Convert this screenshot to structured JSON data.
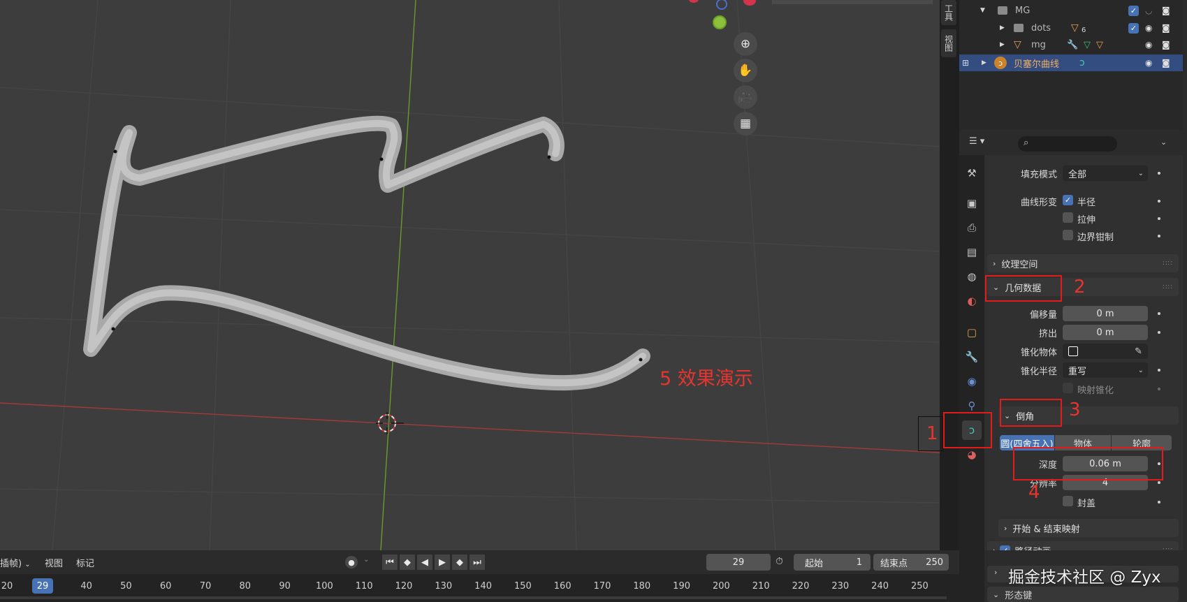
{
  "viewport": {
    "demo_label": "5 效果演示"
  },
  "side_tabs": [
    "工具",
    "视图"
  ],
  "outliner": {
    "rows": [
      {
        "name": "MG",
        "icon": "collection-icon"
      },
      {
        "name": "dots",
        "icon": "collection-icon",
        "badge": "6"
      },
      {
        "name": "mg",
        "icon": "mesh-icon"
      },
      {
        "name": "贝塞尔曲线",
        "icon": "curve-icon"
      }
    ]
  },
  "properties": {
    "fill_mode_label": "填充模式",
    "fill_mode_value": "全部",
    "curve_deform_label": "曲线形变",
    "radius_label": "半径",
    "stretch_label": "拉伸",
    "bounds_clamp_label": "边界钳制",
    "texture_space_label": "纹理空间",
    "geometry_label": "几何数据",
    "offset_label": "偏移量",
    "offset_value": "0 m",
    "extrude_label": "挤出",
    "extrude_value": "0 m",
    "taper_object_label": "锥化物体",
    "taper_radius_label": "锥化半径",
    "taper_radius_value": "重写",
    "map_taper_label": "映射锥化",
    "bevel_label": "倒角",
    "bevel_modes": [
      "圆(四舍五入)",
      "物体",
      "轮廓"
    ],
    "depth_label": "深度",
    "depth_value": "0.06 m",
    "resolution_label": "分辨率",
    "resolution_value": "4",
    "fill_caps_label": "封盖",
    "start_end_label": "开始 & 结束映射",
    "path_anim_label": "路径动画",
    "shape_keys_label": "形态键"
  },
  "annotations": [
    "1",
    "2",
    "3",
    "4"
  ],
  "timeline": {
    "menu_interp": "插帧)",
    "menu_view": "视图",
    "menu_marker": "标记",
    "current_frame": "29",
    "start_label": "起始",
    "start_value": "1",
    "end_label": "结束点",
    "end_value": "250",
    "ticks": [
      "20",
      "40",
      "50",
      "60",
      "70",
      "80",
      "90",
      "100",
      "110",
      "120",
      "130",
      "140",
      "150",
      "160",
      "170",
      "180",
      "190",
      "200",
      "210",
      "220",
      "230",
      "240",
      "250"
    ]
  },
  "watermark": "掘金技术社区 @ Zyx",
  "colors": {
    "accent": "#4772b3",
    "highlight": "#e21b1b",
    "active_tab": "#45c7b0"
  }
}
